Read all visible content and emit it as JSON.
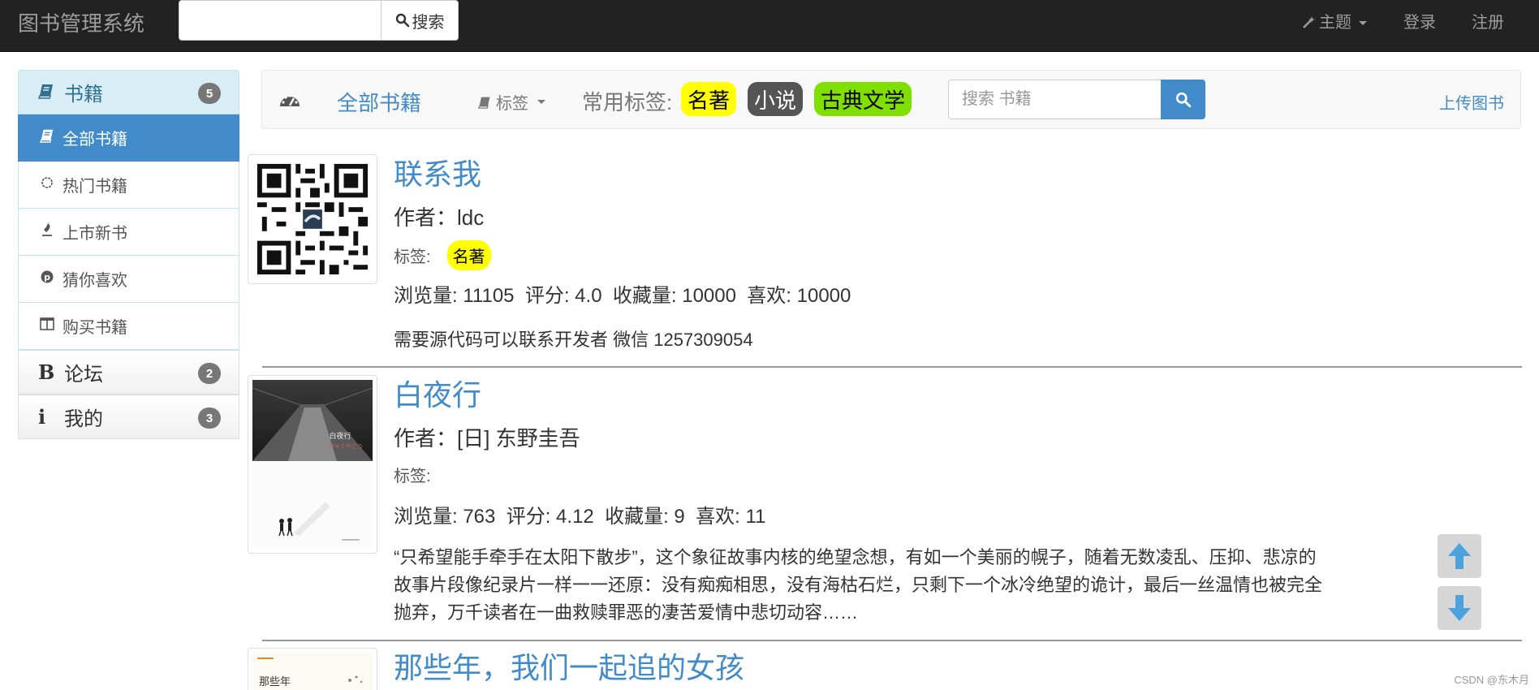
{
  "navbar": {
    "brand": "图书管理系统",
    "search_button": "搜索",
    "theme": "主题",
    "login": "登录",
    "register": "注册"
  },
  "sidebar": {
    "books_header": {
      "label": "书籍",
      "badge": "5"
    },
    "items": [
      {
        "label": "全部书籍",
        "icon": "book-icon",
        "active": true
      },
      {
        "label": "热门书籍",
        "icon": "fire-icon",
        "active": false
      },
      {
        "label": "上市新书",
        "icon": "pen-icon",
        "active": false
      },
      {
        "label": "猜你喜欢",
        "icon": "pinterest-icon",
        "active": false
      },
      {
        "label": "购买书籍",
        "icon": "columns-icon",
        "active": false
      }
    ],
    "forum_header": {
      "label": "论坛",
      "badge": "2"
    },
    "mine_header": {
      "label": "我的",
      "badge": "3"
    }
  },
  "filterbar": {
    "all_books": "全部书籍",
    "tags": "标签",
    "common_tags_label": "常用标签:",
    "common_tags": [
      {
        "label": "名著",
        "bg": "#ffff00",
        "color": "#000000"
      },
      {
        "label": "小说",
        "bg": "#555555",
        "color": "#ffffff"
      },
      {
        "label": "古典文学",
        "bg": "#7fe000",
        "color": "#000000"
      }
    ],
    "search_placeholder": "搜索 书籍",
    "upload": "上传图书"
  },
  "books": [
    {
      "title": "联系我",
      "author": "作者：ldc",
      "tags_label": "标签:",
      "tags": [
        "名著"
      ],
      "stats": "浏览量: 11105  评分: 4.0  收藏量: 10000  喜欢: 10000",
      "description": "需要源代码可以联系开发者 微信 1257309054"
    },
    {
      "title": "白夜行",
      "author": "作者：[日] 东野圭吾",
      "tags_label": "标签:",
      "tags": [],
      "stats": "浏览量: 763  评分: 4.12  收藏量: 9  喜欢: 11",
      "description": "“只希望能手牵手在太阳下散步”，这个象征故事内核的绝望念想，有如一个美丽的幌子，随着无数凌乱、压抑、悲凉的故事片段像纪录片一样一一还原：没有痴痴相思，没有海枯石烂，只剩下一个冰冷绝望的诡计，最后一丝温情也被完全抛弃，万千读者在一曲救赎罪恶的凄苦爱情中悲切动容……",
      "cover_title": "白夜行",
      "cover_subtitle": "びゃくやこう"
    },
    {
      "title": "那些年，我们一起追的女孩",
      "cover_title": "那些年"
    }
  ],
  "watermark": "CSDN @东木月",
  "colors": {
    "primary": "#428bca",
    "navbar": "#222222",
    "panel_head": "#d9edf7"
  }
}
